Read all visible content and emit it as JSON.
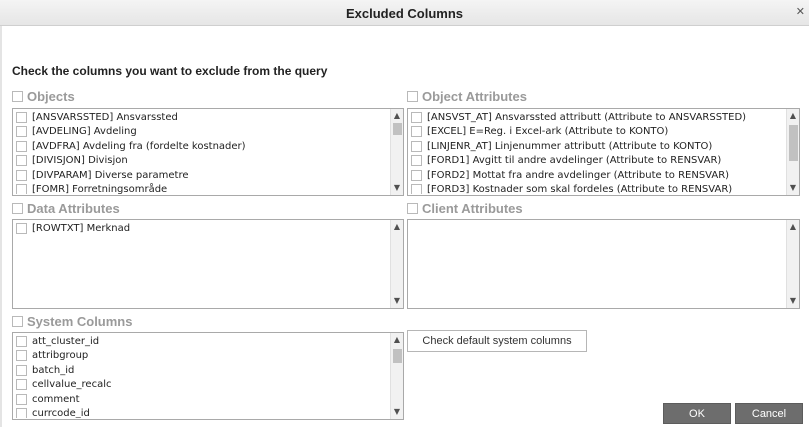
{
  "window": {
    "title": "Excluded Columns",
    "close_glyph": "✕"
  },
  "instruction": "Check the columns you want to exclude from the query",
  "sections": {
    "objects": {
      "title": "Objects",
      "items": [
        "[ANSVARSSTED] Ansvarssted",
        "[AVDELING] Avdeling",
        "[AVDFRA] Avdeling fra (fordelte kostnader)",
        "[DIVISJON] Divisjon",
        "[DIVPARAM] Diverse parametre",
        "[FOMR] Forretningsområde"
      ]
    },
    "object_attributes": {
      "title": "Object Attributes",
      "items": [
        "[ANSVST_AT] Ansvarssted attributt (Attribute to ANSVARSSTED)",
        "[EXCEL] E=Reg. i Excel-ark (Attribute to KONTO)",
        "[LINJENR_AT] Linjenummer attributt (Attribute to KONTO)",
        "[FORD1] Avgitt til andre avdelinger (Attribute to RENSVAR)",
        "[FORD2] Mottat fra andre avdelinger (Attribute to RENSVAR)",
        "[FORD3] Kostnader som skal fordeles (Attribute to RENSVAR)"
      ]
    },
    "data_attributes": {
      "title": "Data Attributes",
      "items": [
        "[ROWTXT] Merknad"
      ]
    },
    "client_attributes": {
      "title": "Client Attributes",
      "items": []
    },
    "system_columns": {
      "title": "System Columns",
      "items": [
        "att_cluster_id",
        "attribgroup",
        "batch_id",
        "cellvalue_recalc",
        "comment",
        "currcode_id"
      ]
    }
  },
  "buttons": {
    "check_default": "Check default system columns",
    "ok": "OK",
    "cancel": "Cancel"
  },
  "icons": {
    "scroll_up": "▲",
    "scroll_down": "▼"
  },
  "colors": {
    "button_dark": "#6d6d6d",
    "section_header": "#9a9a9a"
  }
}
